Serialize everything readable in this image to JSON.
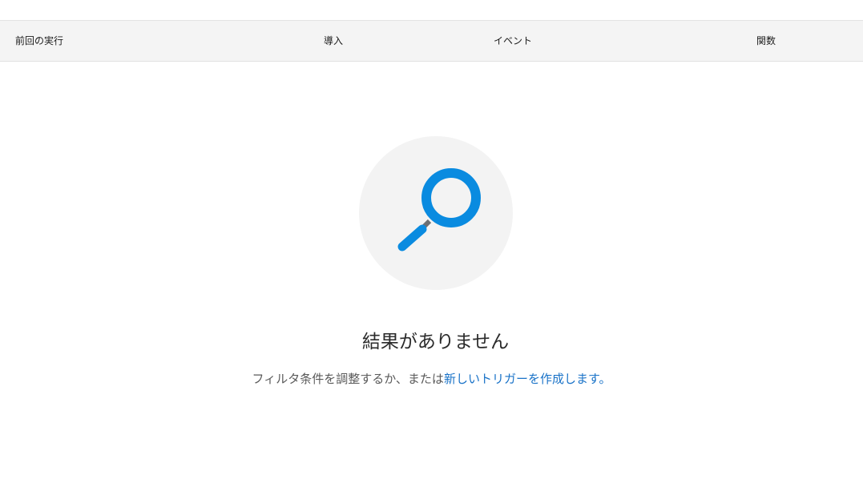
{
  "table": {
    "columns": [
      "前回の実行",
      "導入",
      "イベント",
      "関数"
    ]
  },
  "empty_state": {
    "icon": "magnifier-icon",
    "title": "結果がありません",
    "message_prefix": "フィルタ条件を調整するか、または",
    "link_text": "新しいトリガーを作成します。"
  },
  "colors": {
    "accent": "#0a8be0",
    "link": "#1a73c8",
    "header_bg": "#f4f4f4",
    "illustration_bg": "#f3f3f3"
  }
}
